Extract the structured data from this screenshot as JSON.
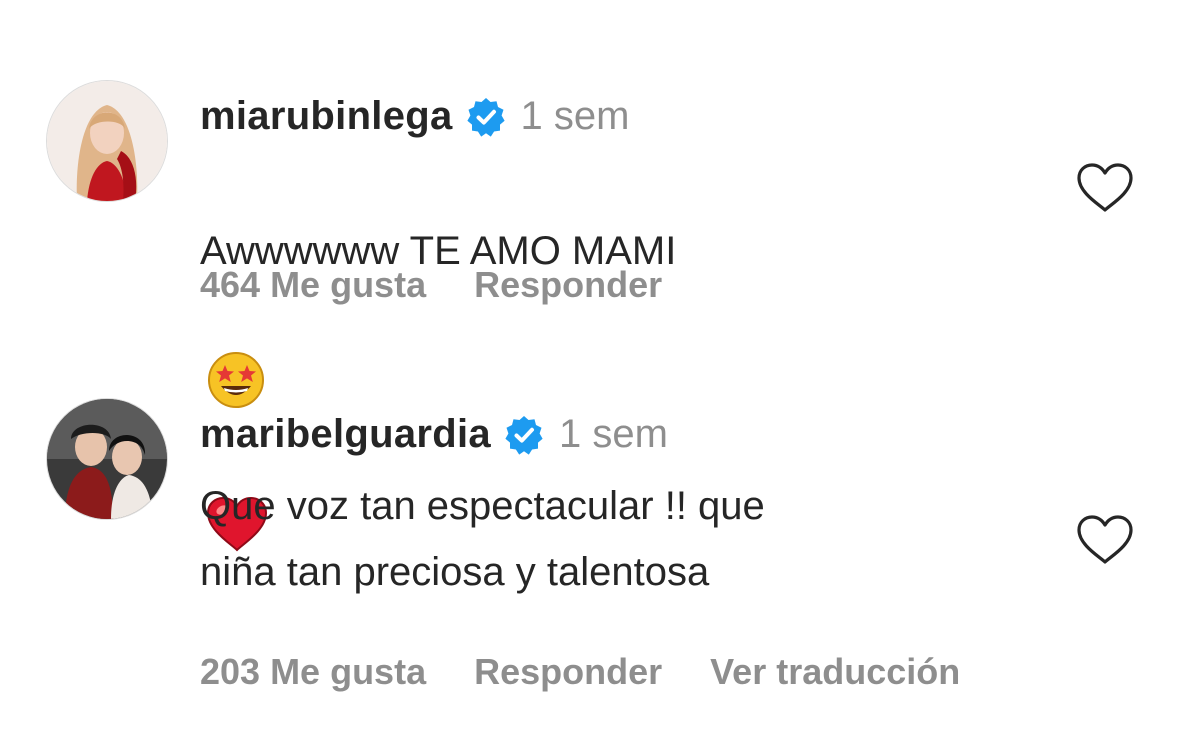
{
  "comments": [
    {
      "username": "miarubinlega",
      "verified": true,
      "time": "1 sem",
      "text": "Awwwwww TE AMO MAMI",
      "emojis": [
        "star-struck-emoji",
        "red-heart-emoji"
      ],
      "likes_label": "464 Me gusta",
      "reply_label": "Responder"
    },
    {
      "username": "maribelguardia",
      "verified": true,
      "time": "1 sem",
      "text": "Que voz tan espectacular !! que\nniña tan preciosa y talentosa",
      "likes_label": "203 Me gusta",
      "reply_label": "Responder",
      "translate_label": "Ver traducción"
    }
  ],
  "colors": {
    "verified_badge": "#1d9bf0",
    "muted_text": "#8e8e8e",
    "primary_text": "#262626"
  },
  "icons": {
    "verified": "verified-badge-icon",
    "like": "heart-outline-icon"
  }
}
